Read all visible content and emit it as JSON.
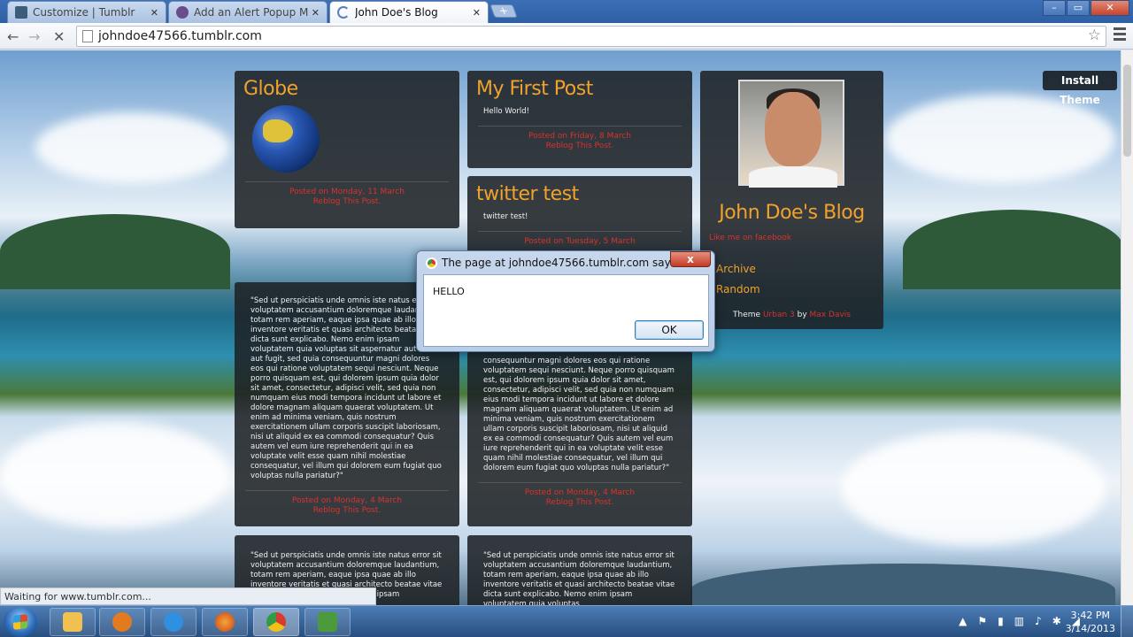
{
  "browser": {
    "tabs": [
      {
        "title": "Customize | Tumblr",
        "favicon_color": "#3b5c7a"
      },
      {
        "title": "Add an Alert Popup Mess",
        "favicon_color": "#6b4c8a"
      },
      {
        "title": "John Doe's Blog",
        "favicon_color": "#cfd8e6"
      }
    ],
    "url": "johndoe47566.tumblr.com",
    "status": "Waiting for www.tumblr.com..."
  },
  "page": {
    "install_theme": "Install Theme",
    "posts": [
      {
        "title": "Globe",
        "meta_date": "Posted on Monday, 11 March",
        "meta_reblog": "Reblog This Post."
      },
      {
        "title": "My First Post",
        "body": "Hello World!",
        "meta_date": "Posted on Friday, 8 March",
        "meta_reblog": "Reblog This Post."
      },
      {
        "title": "twitter test",
        "body": "twitter test!",
        "meta_date": "Posted on Tuesday, 5 March"
      },
      {
        "body": "\"Sed ut perspiciatis unde omnis iste natus error sit voluptatem accusantium doloremque laudantium, totam rem aperiam, eaque ipsa quae ab illo inventore veritatis et quasi architecto beatae vitae dicta sunt explicabo. Nemo enim ipsam voluptatem quia voluptas sit aspernatur aut odit aut fugit, sed quia consequuntur magni dolores eos qui ratione voluptatem sequi nesciunt. Neque porro quisquam est, qui dolorem ipsum quia dolor sit amet, consectetur, adipisci velit, sed quia non numquam eius modi tempora incidunt ut labore et dolore magnam aliquam quaerat voluptatem. Ut enim ad minima veniam, quis nostrum exercitationem ullam corporis suscipit laboriosam, nisi ut aliquid ex ea commodi consequatur? Quis autem vel eum iure reprehenderit qui in ea voluptate velit esse quam nihil molestiae consequatur, vel illum qui dolorem eum fugiat quo voluptas nulla pariatur?\"",
        "meta_date": "Posted on Monday, 4 March",
        "meta_reblog": "Reblog This Post."
      },
      {
        "body": "consequuntur magni dolores eos qui ratione voluptatem sequi nesciunt. Neque porro quisquam est, qui dolorem ipsum quia dolor sit amet, consectetur, adipisci velit, sed quia non numquam eius modi tempora incidunt ut labore et dolore magnam aliquam quaerat voluptatem. Ut enim ad minima veniam, quis nostrum exercitationem ullam corporis suscipit laboriosam, nisi ut aliquid ex ea commodi consequatur? Quis autem vel eum iure reprehenderit qui in ea voluptate velit esse quam nihil molestiae consequatur, vel illum qui dolorem eum fugiat quo voluptas nulla pariatur?\"",
        "meta_date": "Posted on Monday, 4 March",
        "meta_reblog": "Reblog This Post."
      },
      {
        "body": "\"Sed ut perspiciatis unde omnis iste natus error sit voluptatem accusantium doloremque laudantium, totam rem aperiam, eaque ipsa quae ab illo inventore veritatis et quasi architecto beatae vitae dicta sunt explicabo. Nemo enim ipsam voluptatem quia voluptas"
      },
      {
        "body": "\"Sed ut perspiciatis unde omnis iste natus error sit voluptatem accusantium doloremque laudantium, totam rem aperiam, eaque ipsa quae ab illo inventore veritatis et quasi architecto beatae vitae dicta sunt explicabo. Nemo enim ipsam voluptatem quia voluptas"
      }
    ],
    "sidebar": {
      "blog_title": "John Doe's Blog",
      "facebook_link": "Like me on facebook",
      "archive": "Archive",
      "random": "Random",
      "credit_prefix": "Theme",
      "credit_theme": "Urban 3",
      "credit_by": "by",
      "credit_author": "Max Davis"
    }
  },
  "dialog": {
    "title": "The page at johndoe47566.tumblr.com says:",
    "close": "x",
    "message": "HELLO",
    "ok": "OK"
  },
  "taskbar": {
    "time": "3:42 PM",
    "date": "3/14/2013"
  }
}
